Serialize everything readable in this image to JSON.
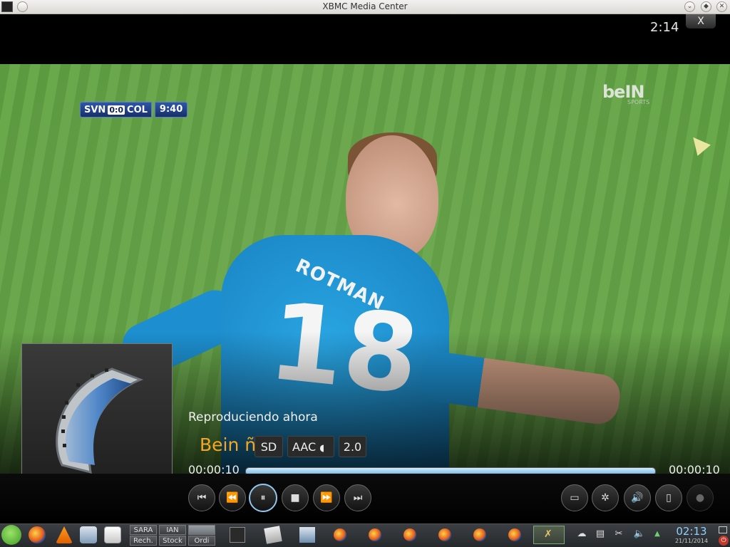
{
  "window": {
    "title": "XBMC Media Center"
  },
  "overlay": {
    "clock": "2:14",
    "close_label": "X"
  },
  "video": {
    "scoreboard": {
      "teams": "SVN",
      "score": "0:0",
      "team_right": "COL",
      "match_time": "9:40"
    },
    "channel_logo": "beIN",
    "channel_logo_sub": "SPORTS",
    "jersey_name": "ROTMAN",
    "jersey_number": "18"
  },
  "now_playing": {
    "heading": "Reproduciendo ahora",
    "title": "Bein ñ",
    "badges": [
      "SD",
      "AAC",
      "2.0"
    ],
    "time_elapsed": "00:00:10",
    "time_total": "00:00:10",
    "progress_percent": 100
  },
  "controls": {
    "left": [
      "skip-previous",
      "rewind",
      "pause",
      "stop",
      "fast-forward",
      "skip-next"
    ],
    "right": [
      "subtitles",
      "video-settings",
      "audio-settings",
      "info",
      "record"
    ]
  },
  "taskbar": {
    "workspaces": [
      {
        "label": "SARA"
      },
      {
        "label": "IAN"
      },
      {
        "label": ""
      },
      {
        "label": "Rech."
      },
      {
        "label": "Stock"
      },
      {
        "label": "Ordi"
      }
    ],
    "clock": "02:13",
    "date": "21/11/2014"
  },
  "colors": {
    "accent": "#f5a623",
    "progress": "#8fc7ee",
    "clock_tray": "#8fd0ff"
  }
}
